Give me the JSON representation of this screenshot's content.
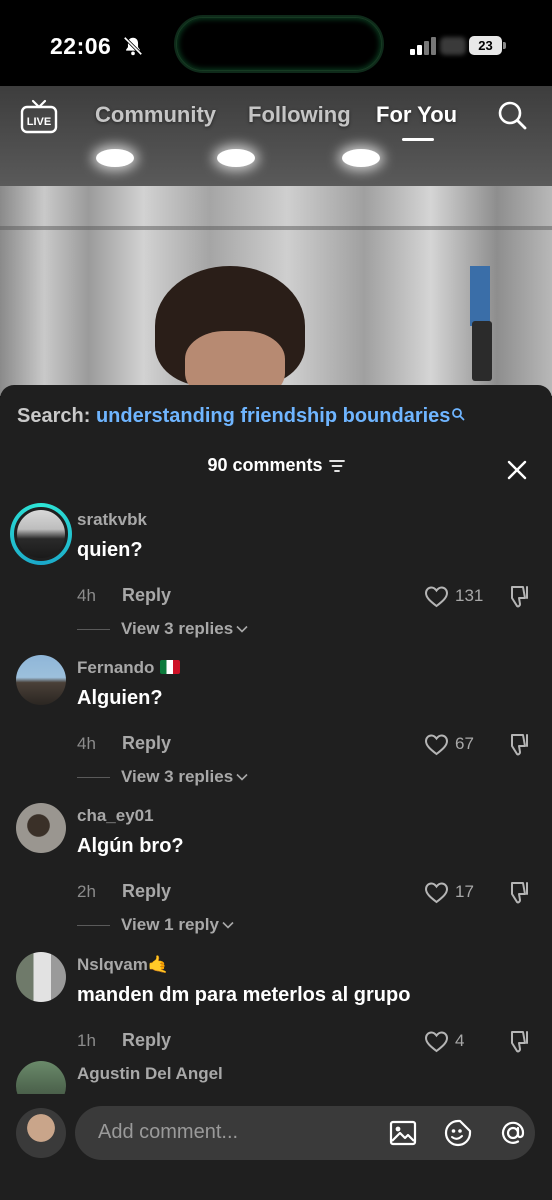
{
  "status_bar": {
    "time": "22:06",
    "battery": "23"
  },
  "top_nav": {
    "tabs": [
      {
        "label": "Community",
        "active": false
      },
      {
        "label": "Following",
        "active": false
      },
      {
        "label": "For You",
        "active": true
      }
    ],
    "live_label": "LIVE"
  },
  "search_suggestion": {
    "label": "Search:",
    "term": "understanding friendship boundaries"
  },
  "comments_header": {
    "count_label": "90 comments"
  },
  "comments": [
    {
      "username": "sratkvbk",
      "text": "quien?",
      "time": "4h",
      "reply_label": "Reply",
      "likes": "131",
      "view_replies": "View 3 replies"
    },
    {
      "username": "Fernando",
      "text": "Alguien?",
      "time": "4h",
      "reply_label": "Reply",
      "likes": "67",
      "view_replies": "View 3 replies"
    },
    {
      "username": "cha_ey01",
      "text": "Algún bro?",
      "time": "2h",
      "reply_label": "Reply",
      "likes": "17",
      "view_replies": "View 1 reply"
    },
    {
      "username": "Nslqvam🤙",
      "text": "manden dm para meterlos al grupo",
      "time": "1h",
      "reply_label": "Reply",
      "likes": "4"
    },
    {
      "username": "Agustin Del Angel"
    }
  ],
  "comment_input": {
    "placeholder": "Add comment..."
  },
  "colors": {
    "sheet_bg": "#1f1f1f",
    "link_blue": "#6fb5ff",
    "muted_text": "#a8a8a8",
    "story_ring": "#2ee6d6"
  }
}
